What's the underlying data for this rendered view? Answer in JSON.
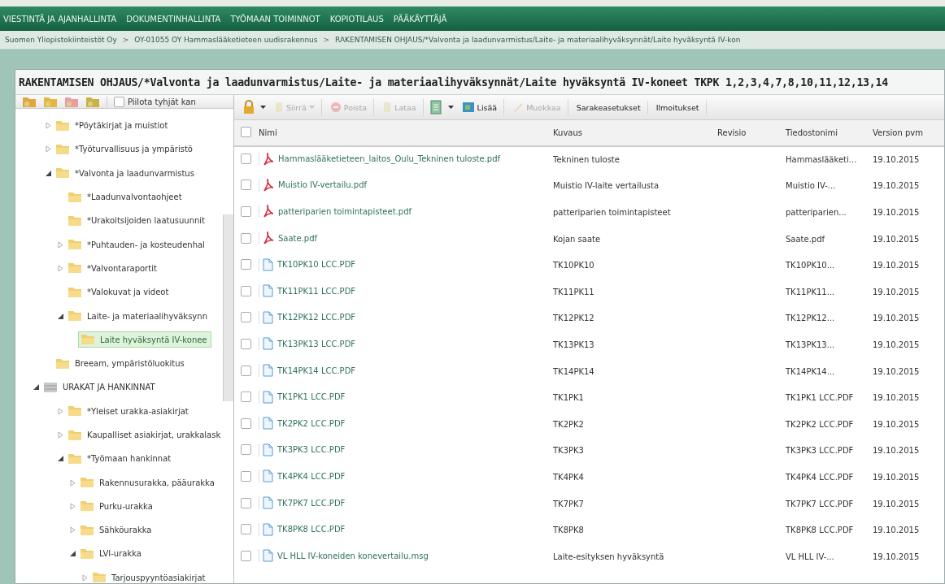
{
  "nav": {
    "items": [
      {
        "label": "VIESTINTÄ JA AJANHALLINTA"
      },
      {
        "label": "DOKUMENTINHALLINTA"
      },
      {
        "label": "TYÖMAAN TOIMINNOT"
      },
      {
        "label": "KOPIOTILAUS"
      },
      {
        "label": "PÄÄKÄYTTÄJÄ"
      }
    ]
  },
  "breadcrumb": {
    "separator": ">",
    "items": [
      "Suomen Yliopistokiinteistöt Oy",
      "OY-01055 OY Hammaslääketieteen uudisrakennus",
      "RAKENTAMISEN OHJAUS/*Valvonta ja laadunvarmistus/Laite- ja materiaalihyväksynnät/Laite hyväksyntä IV-kon"
    ]
  },
  "panel": {
    "title": "RAKENTAMISEN OHJAUS/*Valvonta ja laadunvarmistus/Laite- ja materiaalihyväksynnät/Laite hyväksyntä IV-koneet TKPK 1,2,3,4,7,8,10,11,12,13,14"
  },
  "sidebar": {
    "hide_empty": {
      "label": "Piilota tyhjät kan",
      "checked": false
    },
    "tree": [
      {
        "label": "*Pöytäkirjat ja muistiot",
        "kind": "folder",
        "expanded": false,
        "selected": false
      },
      {
        "label": "*Työturvallisuus ja ympäristö",
        "kind": "folder",
        "expanded": false,
        "selected": false
      },
      {
        "label": "*Valvonta ja laadunvarmistus",
        "kind": "folder",
        "expanded": true,
        "selected": false,
        "children": [
          {
            "label": "*Laadunvalvontaohjeet",
            "kind": "folder",
            "selected": false
          },
          {
            "label": "*Urakoitsijoiden laatusuunnit",
            "kind": "folder",
            "selected": false
          },
          {
            "label": "*Puhtauden- ja kosteudenhal",
            "kind": "folder",
            "expanded": false,
            "selected": false
          },
          {
            "label": "*Valvontaraportit",
            "kind": "folder",
            "expanded": false,
            "selected": false
          },
          {
            "label": "*Valokuvat ja videot",
            "kind": "folder",
            "selected": false
          },
          {
            "label": "Laite- ja materiaalihyväksynn",
            "kind": "folder",
            "expanded": true,
            "selected": false,
            "children": [
              {
                "label": "Laite hyväksyntä IV-konee",
                "kind": "folder",
                "selected": true
              }
            ]
          }
        ]
      },
      {
        "label": "Breeam, ympäristöluokitus",
        "kind": "folder",
        "selected": false
      },
      {
        "label": "URAKAT JA HANKINNAT",
        "kind": "root",
        "expanded": true,
        "selected": false,
        "children": [
          {
            "label": "*Yleiset urakka-asiakirjat",
            "kind": "folder",
            "expanded": false,
            "selected": false
          },
          {
            "label": "Kaupalliset asiakirjat, urakkalask",
            "kind": "folder",
            "expanded": false,
            "selected": false
          },
          {
            "label": "*Työmaan hankinnat",
            "kind": "folder",
            "expanded": true,
            "selected": false,
            "children": [
              {
                "label": "Rakennusurakka, pääurakka",
                "kind": "folder",
                "expanded": false,
                "selected": false
              },
              {
                "label": "Purku-urakka",
                "kind": "folder",
                "expanded": false,
                "selected": false
              },
              {
                "label": "Sähköurakka",
                "kind": "folder",
                "expanded": false,
                "selected": false
              },
              {
                "label": "LVI-urakka",
                "kind": "folder",
                "expanded": true,
                "selected": false,
                "children": [
                  {
                    "label": "Tarjouspyyntöasiakirjat",
                    "kind": "folder",
                    "expanded": false,
                    "selected": false
                  }
                ]
              }
            ]
          }
        ]
      }
    ]
  },
  "toolbar": [
    {
      "label": "Siirrä",
      "disabled": true
    },
    {
      "label": "Poista",
      "disabled": true
    },
    {
      "label": "Lataa",
      "disabled": true
    },
    {
      "label": "Lisää",
      "disabled": false
    },
    {
      "label": "Muokkaa",
      "disabled": true
    },
    {
      "label": "Sarakeasetukset",
      "disabled": false
    },
    {
      "label": "Ilmoitukset",
      "disabled": false
    }
  ],
  "table": {
    "all_checked": false,
    "columns": [
      "Nimi",
      "Kuvaus",
      "Revisio",
      "Tiedostonimi",
      "Version pvm"
    ],
    "rows": [
      {
        "kind": "pdf",
        "checked": false,
        "name": "Hammaslääketieteen_laitos_Oulu_Tekninen tuloste.pdf",
        "description": "Tekninen tuloste",
        "filename": "Hammaslääketi...",
        "date": "19.10.2015"
      },
      {
        "kind": "pdf",
        "checked": false,
        "name": "Muistio IV-vertailu.pdf",
        "description": "Muistio IV-laite vertailusta",
        "filename": "Muistio IV-...",
        "date": "19.10.2015"
      },
      {
        "kind": "pdf",
        "checked": false,
        "name": "patteriparien toimintapisteet.pdf",
        "description": "patteriparien toimintapisteet",
        "filename": "patteriparien...",
        "date": "19.10.2015"
      },
      {
        "kind": "pdf",
        "checked": false,
        "name": "Saate.pdf",
        "description": "Kojan saate",
        "filename": "Saate.pdf",
        "date": "19.10.2015"
      },
      {
        "kind": "file",
        "checked": false,
        "name": "TK10PK10 LCC.PDF",
        "description": "TK10PK10",
        "filename": "TK10PK10...",
        "date": "19.10.2015"
      },
      {
        "kind": "file",
        "checked": false,
        "name": "TK11PK11 LCC.PDF",
        "description": "TK11PK11",
        "filename": "TK11PK11...",
        "date": "19.10.2015"
      },
      {
        "kind": "file",
        "checked": false,
        "name": "TK12PK12 LCC.PDF",
        "description": "TK12PK12",
        "filename": "TK12PK12...",
        "date": "19.10.2015"
      },
      {
        "kind": "file",
        "checked": false,
        "name": "TK13PK13 LCC.PDF",
        "description": "TK13PK13",
        "filename": "TK13PK13...",
        "date": "19.10.2015"
      },
      {
        "kind": "file",
        "checked": false,
        "name": "TK14PK14 LCC.PDF",
        "description": "TK14PK14",
        "filename": "TK14PK14...",
        "date": "19.10.2015"
      },
      {
        "kind": "file",
        "checked": false,
        "name": "TK1PK1 LCC.PDF",
        "description": "TK1PK1",
        "filename": "TK1PK1 LCC.PDF",
        "date": "19.10.2015"
      },
      {
        "kind": "file",
        "checked": false,
        "name": "TK2PK2 LCC.PDF",
        "description": "TK2PK2",
        "filename": "TK2PK2 LCC.PDF",
        "date": "19.10.2015"
      },
      {
        "kind": "file",
        "checked": false,
        "name": "TK3PK3 LCC.PDF",
        "description": "TK3PK3",
        "filename": "TK3PK3 LCC.PDF",
        "date": "19.10.2015"
      },
      {
        "kind": "file",
        "checked": false,
        "name": "TK4PK4 LCC.PDF",
        "description": "TK4PK4",
        "filename": "TK4PK4 LCC.PDF",
        "date": "19.10.2015"
      },
      {
        "kind": "file",
        "checked": false,
        "name": "TK7PK7 LCC.PDF",
        "description": "TK7PK7",
        "filename": "TK7PK7 LCC.PDF",
        "date": "19.10.2015"
      },
      {
        "kind": "file",
        "checked": false,
        "name": "TK8PK8 LCC.PDF",
        "description": "TK8PK8",
        "filename": "TK8PK8 LCC.PDF",
        "date": "19.10.2015"
      },
      {
        "kind": "file",
        "checked": false,
        "name": "VL HLL IV-koneiden konevertailu.msg",
        "description": "Laite-esityksen hyväksyntä",
        "filename": "VL HLL IV-...",
        "date": "19.10.2015"
      }
    ]
  }
}
